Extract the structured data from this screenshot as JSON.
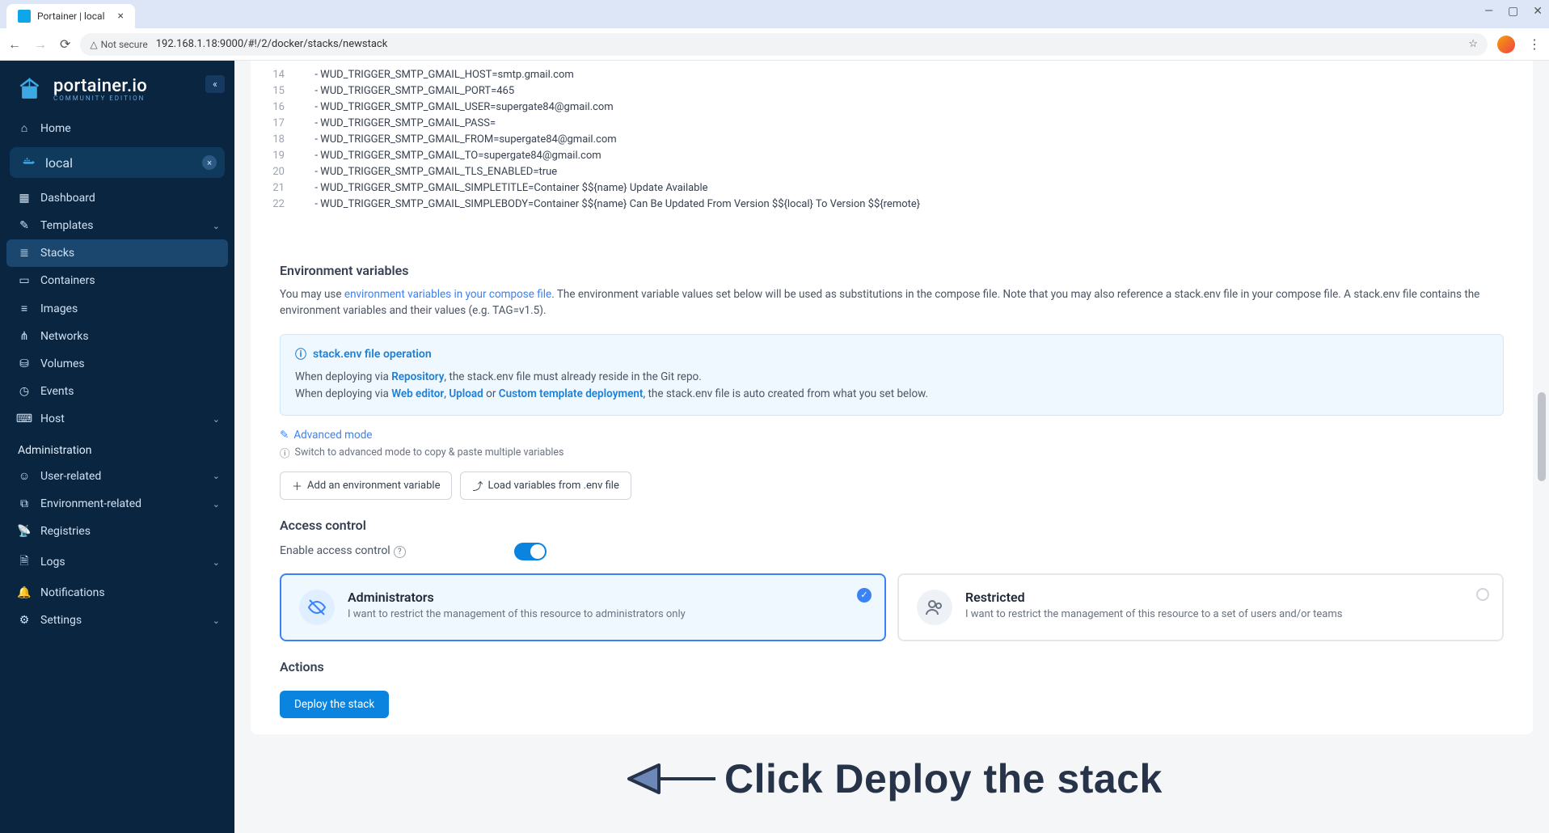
{
  "browser": {
    "tab_title": "Portainer | local",
    "security_label": "Not secure",
    "url": "192.168.1.18:9000/#!/2/docker/stacks/newstack"
  },
  "sidebar": {
    "brand": "portainer.io",
    "brand_sub": "COMMUNITY EDITION",
    "home": "Home",
    "env_name": "local",
    "items": {
      "dashboard": "Dashboard",
      "templates": "Templates",
      "stacks": "Stacks",
      "containers": "Containers",
      "images": "Images",
      "networks": "Networks",
      "volumes": "Volumes",
      "events": "Events",
      "host": "Host"
    },
    "admin_header": "Administration",
    "admin": {
      "user_related": "User-related",
      "env_related": "Environment-related",
      "registries": "Registries",
      "logs": "Logs",
      "notifications": "Notifications",
      "settings": "Settings"
    }
  },
  "editor": {
    "lines": [
      {
        "n": "14",
        "t": "      - WUD_TRIGGER_SMTP_GMAIL_HOST=smtp.gmail.com"
      },
      {
        "n": "15",
        "t": "      - WUD_TRIGGER_SMTP_GMAIL_PORT=465"
      },
      {
        "n": "16",
        "t": "      - WUD_TRIGGER_SMTP_GMAIL_USER=supergate84@gmail.com"
      },
      {
        "n": "17",
        "t": "      - WUD_TRIGGER_SMTP_GMAIL_PASS="
      },
      {
        "n": "18",
        "t": "      - WUD_TRIGGER_SMTP_GMAIL_FROM=supergate84@gmail.com"
      },
      {
        "n": "19",
        "t": "      - WUD_TRIGGER_SMTP_GMAIL_TO=supergate84@gmail.com"
      },
      {
        "n": "20",
        "t": "      - WUD_TRIGGER_SMTP_GMAIL_TLS_ENABLED=true"
      },
      {
        "n": "21",
        "t": "      - WUD_TRIGGER_SMTP_GMAIL_SIMPLETITLE=Container $${name} Update Available"
      },
      {
        "n": "22",
        "t": "      - WUD_TRIGGER_SMTP_GMAIL_SIMPLEBODY=Container $${name} Can Be Updated From Version $${local} To Version $${remote}"
      }
    ]
  },
  "env": {
    "title": "Environment variables",
    "desc_pre": "You may use ",
    "desc_link": "environment variables in your compose file",
    "desc_post": ". The environment variable values set below will be used as substitutions in the compose file. Note that you may also reference a stack.env file in your compose file. A stack.env file contains the environment variables and their values (e.g. TAG=v1.5).",
    "info_title": "stack.env file operation",
    "info_l1_pre": "When deploying via ",
    "info_l1_b1": "Repository",
    "info_l1_post": ", the stack.env file must already reside in the Git repo.",
    "info_l2_pre": "When deploying via ",
    "info_l2_b1": "Web editor",
    "info_l2_sep1": ", ",
    "info_l2_b2": "Upload",
    "info_l2_sep2": " or ",
    "info_l2_b3": "Custom template deployment",
    "info_l2_post": ", the stack.env file is auto created from what you set below.",
    "adv_mode": "Advanced mode",
    "adv_hint": "Switch to advanced mode to copy & paste multiple variables",
    "btn_add": "Add an environment variable",
    "btn_load": "Load variables from .env file"
  },
  "access": {
    "title": "Access control",
    "enable_label": "Enable access control",
    "admin_title": "Administrators",
    "admin_desc": "I want to restrict the management of this resource to administrators only",
    "restr_title": "Restricted",
    "restr_desc": "I want to restrict the management of this resource to a set of users and/or teams"
  },
  "actions": {
    "title": "Actions",
    "deploy": "Deploy the stack"
  },
  "annotation": {
    "text": "Click Deploy the stack"
  }
}
